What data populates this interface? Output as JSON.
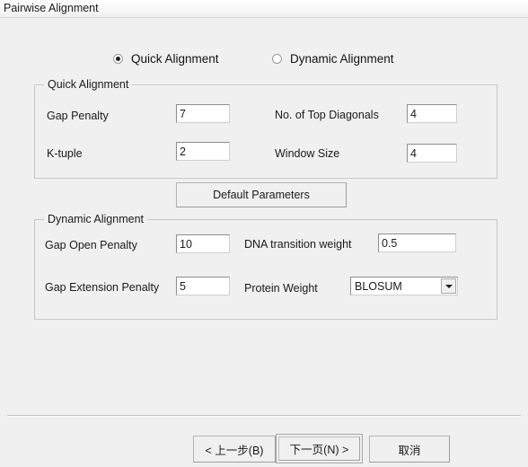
{
  "window": {
    "title": "Pairwise Alignment"
  },
  "mode_selector": {
    "options": [
      {
        "label": "Quick Alignment",
        "selected": true
      },
      {
        "label": "Dynamic Alignment",
        "selected": false
      }
    ]
  },
  "quick_group": {
    "title": "Quick Alignment",
    "fields": [
      {
        "label": "Gap Penalty",
        "value": "7"
      },
      {
        "label": "No. of Top Diagonals",
        "value": "4"
      },
      {
        "label": "K-tuple",
        "value": "2"
      },
      {
        "label": "Window Size",
        "value": "4"
      }
    ],
    "default_button": "Default Parameters"
  },
  "dynamic_group": {
    "title": "Dynamic Alignment",
    "fields": [
      {
        "label": "Gap Open Penalty",
        "value": "10"
      },
      {
        "label": "DNA transition weight",
        "value": "0.5"
      },
      {
        "label": "Gap Extension Penalty",
        "value": "5"
      }
    ],
    "protein_weight": {
      "label": "Protein Weight",
      "selected": "BLOSUM"
    }
  },
  "footer": {
    "back_label": "< 上一步(B)",
    "next_label": "下一页(N) >",
    "cancel_label": "取消"
  }
}
